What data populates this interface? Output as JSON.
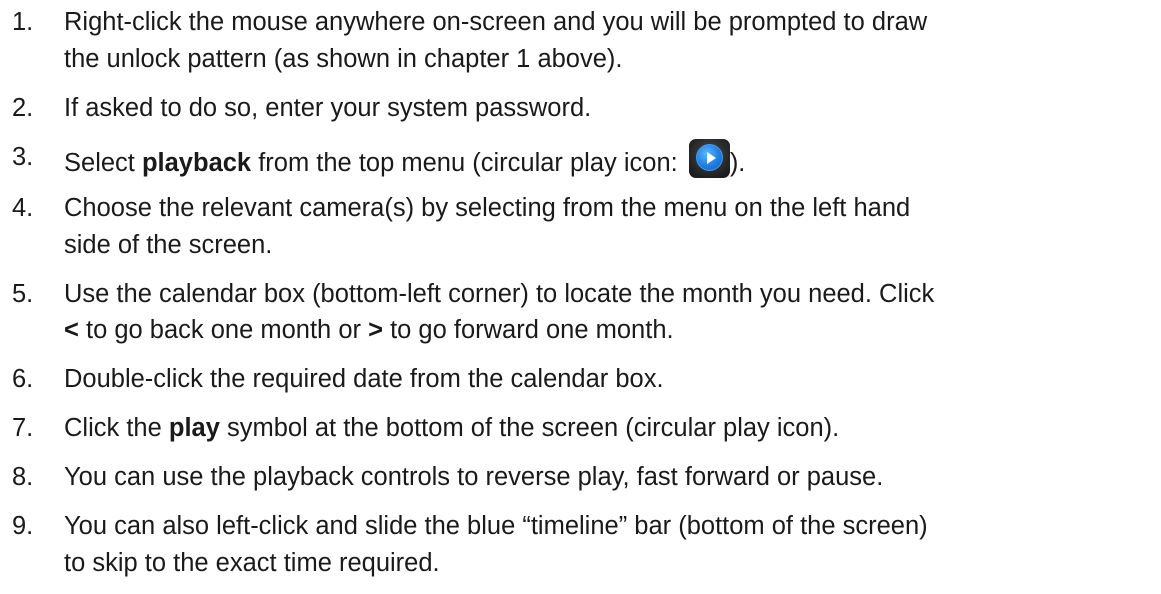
{
  "steps": [
    {
      "num": "1.",
      "lines": [
        "Right-click the mouse anywhere on-screen and you will be prompted to draw",
        "the unlock pattern (as shown in chapter 1 above)."
      ]
    },
    {
      "num": "2.",
      "text": "If asked to do so, enter your system password."
    },
    {
      "num": "3.",
      "pre": "Select ",
      "bold": "playback",
      "post": " from the top menu (circular play icon: ",
      "icon": "circular-play-icon",
      "end": ")."
    },
    {
      "num": "4.",
      "lines": [
        "Choose the relevant camera(s) by selecting from the menu on the left hand",
        "side of the screen."
      ]
    },
    {
      "num": "5.",
      "line1": "Use the calendar box (bottom-left corner) to locate the month you need. Click",
      "lt": "<",
      "mid": " to go back one month or ",
      "gt": ">",
      "tail": " to go forward one month."
    },
    {
      "num": "6.",
      "text": "Double-click the required date from the calendar box."
    },
    {
      "num": "7.",
      "pre": "Click the ",
      "bold": "play",
      "post": " symbol at the bottom of the screen (circular play icon)."
    },
    {
      "num": "8.",
      "text": "You can use the playback controls to reverse play, fast forward or pause."
    },
    {
      "num": "9.",
      "lines": [
        "You can also left-click and slide the blue “timeline” bar (bottom of the screen)",
        "to skip to the exact time required."
      ]
    }
  ],
  "colors": {
    "text": "#1a1a1a",
    "icon_background": "#202020",
    "icon_disc": "#1f7fe0"
  }
}
